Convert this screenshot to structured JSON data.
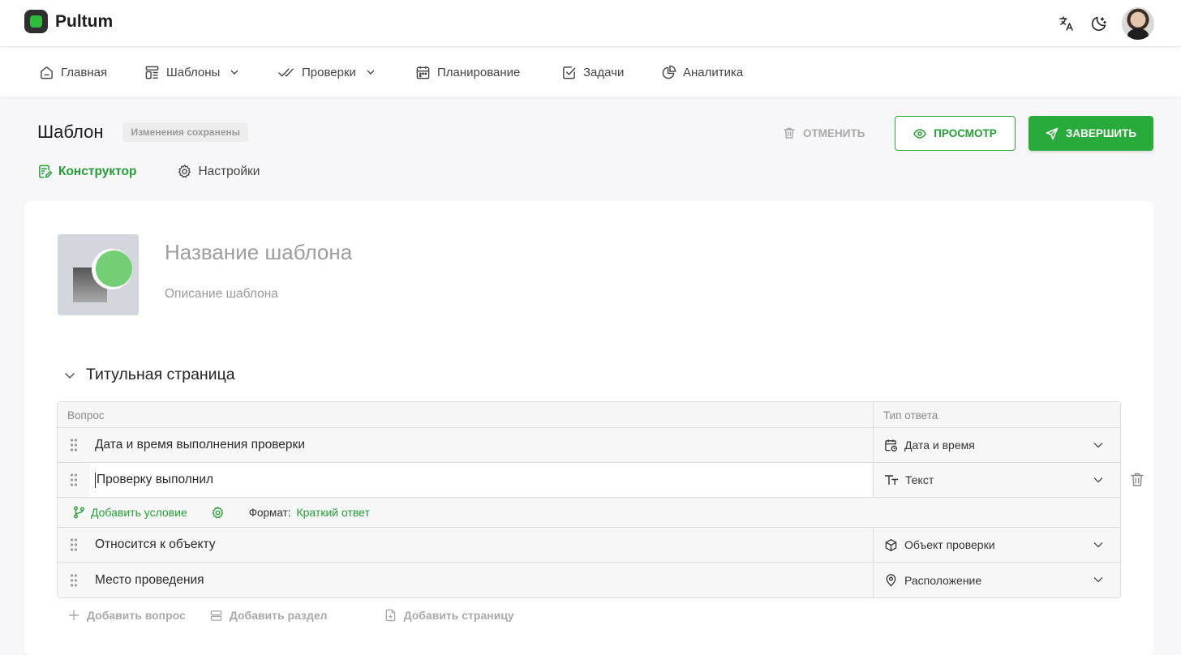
{
  "app": {
    "name": "Pultum"
  },
  "nav": [
    {
      "label": "Главная",
      "icon": "home-icon"
    },
    {
      "label": "Шаблоны",
      "icon": "templates-icon",
      "dropdown": true
    },
    {
      "label": "Проверки",
      "icon": "checks-icon",
      "dropdown": true
    },
    {
      "label": "Планирование",
      "icon": "calendar-icon"
    },
    {
      "label": "Задачи",
      "icon": "task-icon"
    },
    {
      "label": "Аналитика",
      "icon": "pie-chart-icon"
    }
  ],
  "page": {
    "title": "Шаблон",
    "status_badge": "Изменения сохранены",
    "cancel_label": "ОТМЕНИТЬ",
    "preview_label": "ПРОСМОТР",
    "finish_label": "ЗАВЕРШИТЬ",
    "tabs": [
      {
        "label": "Конструктор",
        "active": true
      },
      {
        "label": "Настройки",
        "active": false
      }
    ]
  },
  "template": {
    "name_placeholder": "Название шаблона",
    "description_placeholder": "Описание шаблона"
  },
  "section": {
    "title": "Титульная страница",
    "headers": {
      "question": "Вопрос",
      "answer_type": "Тип ответа"
    },
    "questions": [
      {
        "text": "Дата и время выполнения проверки",
        "answer_type": "Дата и время",
        "icon": "calendar-clock-icon"
      },
      {
        "text": "Проверку выполнил",
        "answer_type": "Текст",
        "icon": "text-type-icon",
        "active": true
      },
      {
        "text": "Относится к объекту",
        "answer_type": "Объект проверки",
        "icon": "cube-icon"
      },
      {
        "text": "Место проведения",
        "answer_type": "Расположение",
        "icon": "location-pin-icon"
      }
    ],
    "condition": {
      "add_condition": "Добавить условие",
      "format_label": "Формат:",
      "format_value": "Краткий ответ"
    }
  },
  "actions": {
    "add_question": "Добавить вопрос",
    "add_section": "Добавить раздел",
    "add_page": "Добавить страницу"
  },
  "colors": {
    "accent": "#29ab3b",
    "text": "#2b2b2b",
    "muted": "#a9a9a9"
  }
}
